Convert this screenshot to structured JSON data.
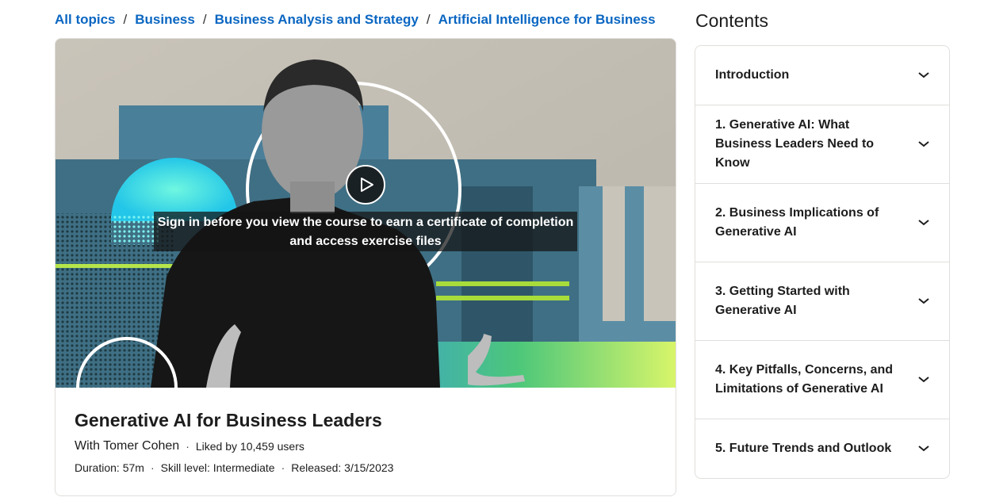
{
  "breadcrumb": {
    "items": [
      "All topics",
      "Business",
      "Business Analysis and Strategy",
      "Artificial Intelligence for Business"
    ],
    "separator": "/"
  },
  "video": {
    "overlay_text_line1": "Sign in before you view the course to earn a certificate of completion",
    "overlay_text_line2": "and access exercise files",
    "play_icon": "play-icon"
  },
  "course": {
    "title": "Generative AI for Business Leaders",
    "instructor": "With Tomer Cohen",
    "likes": "Liked by 10,459 users",
    "duration": "Duration: 57m",
    "skill_level": "Skill level: Intermediate",
    "released": "Released: 3/15/2023",
    "separator": "·"
  },
  "contents": {
    "heading": "Contents",
    "sections": [
      {
        "label": "Introduction"
      },
      {
        "label": "1. Generative AI: What Business Leaders Need to Know"
      },
      {
        "label": "2. Business Implications of Generative AI"
      },
      {
        "label": "3. Getting Started with Generative AI"
      },
      {
        "label": "4. Key Pitfalls, Concerns, and Limitations of Generative AI"
      },
      {
        "label": "5. Future Trends and Outlook"
      }
    ],
    "expand_icon": "chevron-down-icon"
  },
  "colors": {
    "link": "#0a66c2",
    "text": "#1d1d1d",
    "border": "#e0dfdc"
  }
}
